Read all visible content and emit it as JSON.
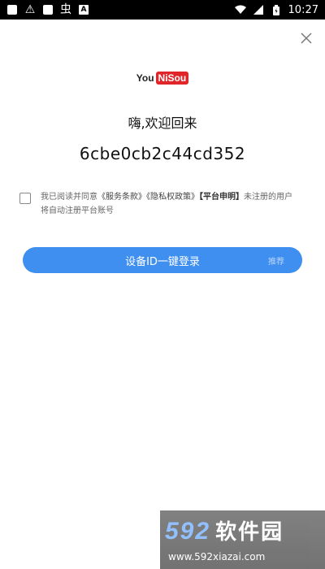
{
  "status_bar": {
    "time": "10:27",
    "left_icons": [
      "square-icon",
      "alert-icon",
      "square-icon",
      "bug-icon",
      "a-icon"
    ],
    "right_icons": [
      "wifi-icon",
      "signal-icon",
      "battery-icon"
    ],
    "glyph_alert": "⚠",
    "glyph_bug": "虫",
    "glyph_a": "A"
  },
  "logo": {
    "part1": "You",
    "part2": "NiSou"
  },
  "welcome_text": "嗨,欢迎回来",
  "device_id": "6cbe0cb2c44cd352",
  "agreement": {
    "prefix": "我已阅读并同意",
    "terms": "《服务条款》",
    "privacy": "《隐私权政策》",
    "statement": "【平台申明】",
    "suffix": "未注册的用户将自动注册平台账号"
  },
  "login_button": {
    "label": "设备ID一键登录",
    "tag": "推荐"
  },
  "watermark": {
    "brand_num": "592",
    "brand_cn": "软件园",
    "url": "www.592xiazai.com"
  },
  "colors": {
    "accent": "#3e8ff0",
    "logo_red": "#e0262b"
  }
}
